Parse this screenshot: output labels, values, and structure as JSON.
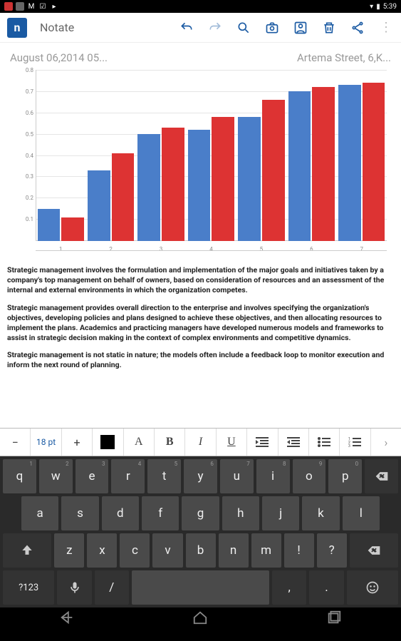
{
  "status": {
    "time": "5:39"
  },
  "app": {
    "title": "Notate"
  },
  "meta": {
    "date": "August 06,2014 05...",
    "location": "Artema Street, 6,K..."
  },
  "chart_data": {
    "type": "bar",
    "categories": [
      "1",
      "2",
      "3",
      "4",
      "5",
      "6",
      "7"
    ],
    "series": [
      {
        "name": "blue",
        "values": [
          0.15,
          0.33,
          0.5,
          0.52,
          0.58,
          0.7,
          0.73
        ]
      },
      {
        "name": "red",
        "values": [
          0.11,
          0.41,
          0.53,
          0.58,
          0.66,
          0.72,
          0.74
        ]
      }
    ],
    "ylim": [
      0,
      0.8
    ],
    "yticks": [
      0.1,
      0.2,
      0.3,
      0.4,
      0.5,
      0.6,
      0.7,
      0.8
    ]
  },
  "body": {
    "p1": "Strategic management involves the formulation and implementation of the major goals and initiatives taken by a company's top management on behalf of owners, based on consideration of resources and an assessment of the internal and external environments in which the organization competes.",
    "p2": "Strategic management provides overall direction to the enterprise and involves specifying the organization's objectives, developing policies and plans designed to achieve these objectives, and then allocating resources to implement the plans. Academics and practicing managers have developed numerous models and frameworks to assist in strategic decision making in the context of complex environments and competitive dynamics.",
    "p3": "Strategic management is not static in nature; the models often include a feedback loop to monitor execution and inform the next round of planning."
  },
  "toolbar": {
    "minus": "−",
    "fontSize": "18 pt",
    "plus": "+",
    "fontA": "A",
    "bold": "B",
    "italic": "I",
    "underline": "U",
    "more": "›"
  },
  "keyboard": {
    "row1": [
      {
        "k": "q",
        "h": "1"
      },
      {
        "k": "w",
        "h": "2"
      },
      {
        "k": "e",
        "h": "3"
      },
      {
        "k": "r",
        "h": "4"
      },
      {
        "k": "t",
        "h": "5"
      },
      {
        "k": "y",
        "h": "6"
      },
      {
        "k": "u",
        "h": "7"
      },
      {
        "k": "i",
        "h": "8"
      },
      {
        "k": "o",
        "h": "9"
      },
      {
        "k": "p",
        "h": "0"
      }
    ],
    "row2": [
      {
        "k": "a"
      },
      {
        "k": "s"
      },
      {
        "k": "d"
      },
      {
        "k": "f"
      },
      {
        "k": "g"
      },
      {
        "k": "h"
      },
      {
        "k": "j"
      },
      {
        "k": "k"
      },
      {
        "k": "l"
      }
    ],
    "row3": [
      {
        "k": "z"
      },
      {
        "k": "x"
      },
      {
        "k": "c"
      },
      {
        "k": "v"
      },
      {
        "k": "b"
      },
      {
        "k": "n"
      },
      {
        "k": "m"
      },
      {
        "k": "!"
      },
      {
        "k": "?"
      }
    ],
    "sym": "?123",
    "slash": "/",
    "comma": ",",
    "period": "."
  }
}
